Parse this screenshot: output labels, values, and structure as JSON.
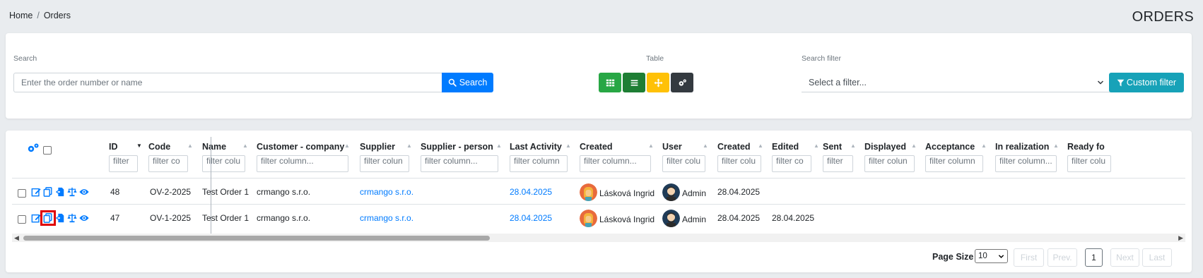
{
  "breadcrumb": {
    "home": "Home",
    "separator": "/",
    "current": "Orders"
  },
  "page_title": "ORDERS",
  "search": {
    "label": "Search",
    "placeholder": "Enter the order number or name",
    "button": "Search"
  },
  "table_view": {
    "label": "Table"
  },
  "search_filter": {
    "label": "Search filter",
    "select_value": "Select a filter...",
    "custom_button": "Custom filter"
  },
  "colors": {
    "primary": "#007bff",
    "success": "#28a745",
    "dark_green": "#1e7e34",
    "warning": "#ffc107",
    "dark": "#343a40",
    "info": "#17a2b8"
  },
  "columns": [
    {
      "label": "ID",
      "filter": "filter"
    },
    {
      "label": "Code",
      "filter": "filter co"
    },
    {
      "label": "Name",
      "filter": "filter colu"
    },
    {
      "label": "Customer - company",
      "filter": "filter column..."
    },
    {
      "label": "Supplier",
      "filter": "filter colun"
    },
    {
      "label": "Supplier - person",
      "filter": "filter column..."
    },
    {
      "label": "Last Activity",
      "filter": "filter column"
    },
    {
      "label": "Created",
      "filter": "filter column..."
    },
    {
      "label": "User",
      "filter": "filter colu"
    },
    {
      "label": "Created",
      "filter": "filter colu"
    },
    {
      "label": "Edited",
      "filter": "filter co"
    },
    {
      "label": "Sent",
      "filter": "filter"
    },
    {
      "label": "Displayed",
      "filter": "filter colun"
    },
    {
      "label": "Acceptance",
      "filter": "filter column"
    },
    {
      "label": "In realization",
      "filter": "filter column..."
    },
    {
      "label": "Ready fo",
      "filter": "filter colu"
    }
  ],
  "rows": [
    {
      "id": "48",
      "code": "OV-2-2025",
      "name": "Test Order 1",
      "customer": "crmango s.r.o.",
      "supplier": "crmango s.r.o.",
      "last_activity": "28.04.2025",
      "created_by": "Lásková Ingrid",
      "user": "Admin",
      "created": "28.04.2025",
      "edited": ""
    },
    {
      "id": "47",
      "code": "OV-1-2025",
      "name": "Test Order 1",
      "customer": "crmango s.r.o.",
      "supplier": "crmango s.r.o.",
      "last_activity": "28.04.2025",
      "created_by": "Lásková Ingrid",
      "user": "Admin",
      "created": "28.04.2025",
      "edited": "28.04.2025"
    }
  ],
  "row_actions": [
    "edit-icon",
    "copy-icon",
    "export-icon",
    "balance-icon",
    "eye-icon"
  ],
  "pagination": {
    "page_size_label": "Page Size",
    "page_size": "10",
    "first": "First",
    "prev": "Prev.",
    "current": "1",
    "next": "Next",
    "last": "Last"
  }
}
